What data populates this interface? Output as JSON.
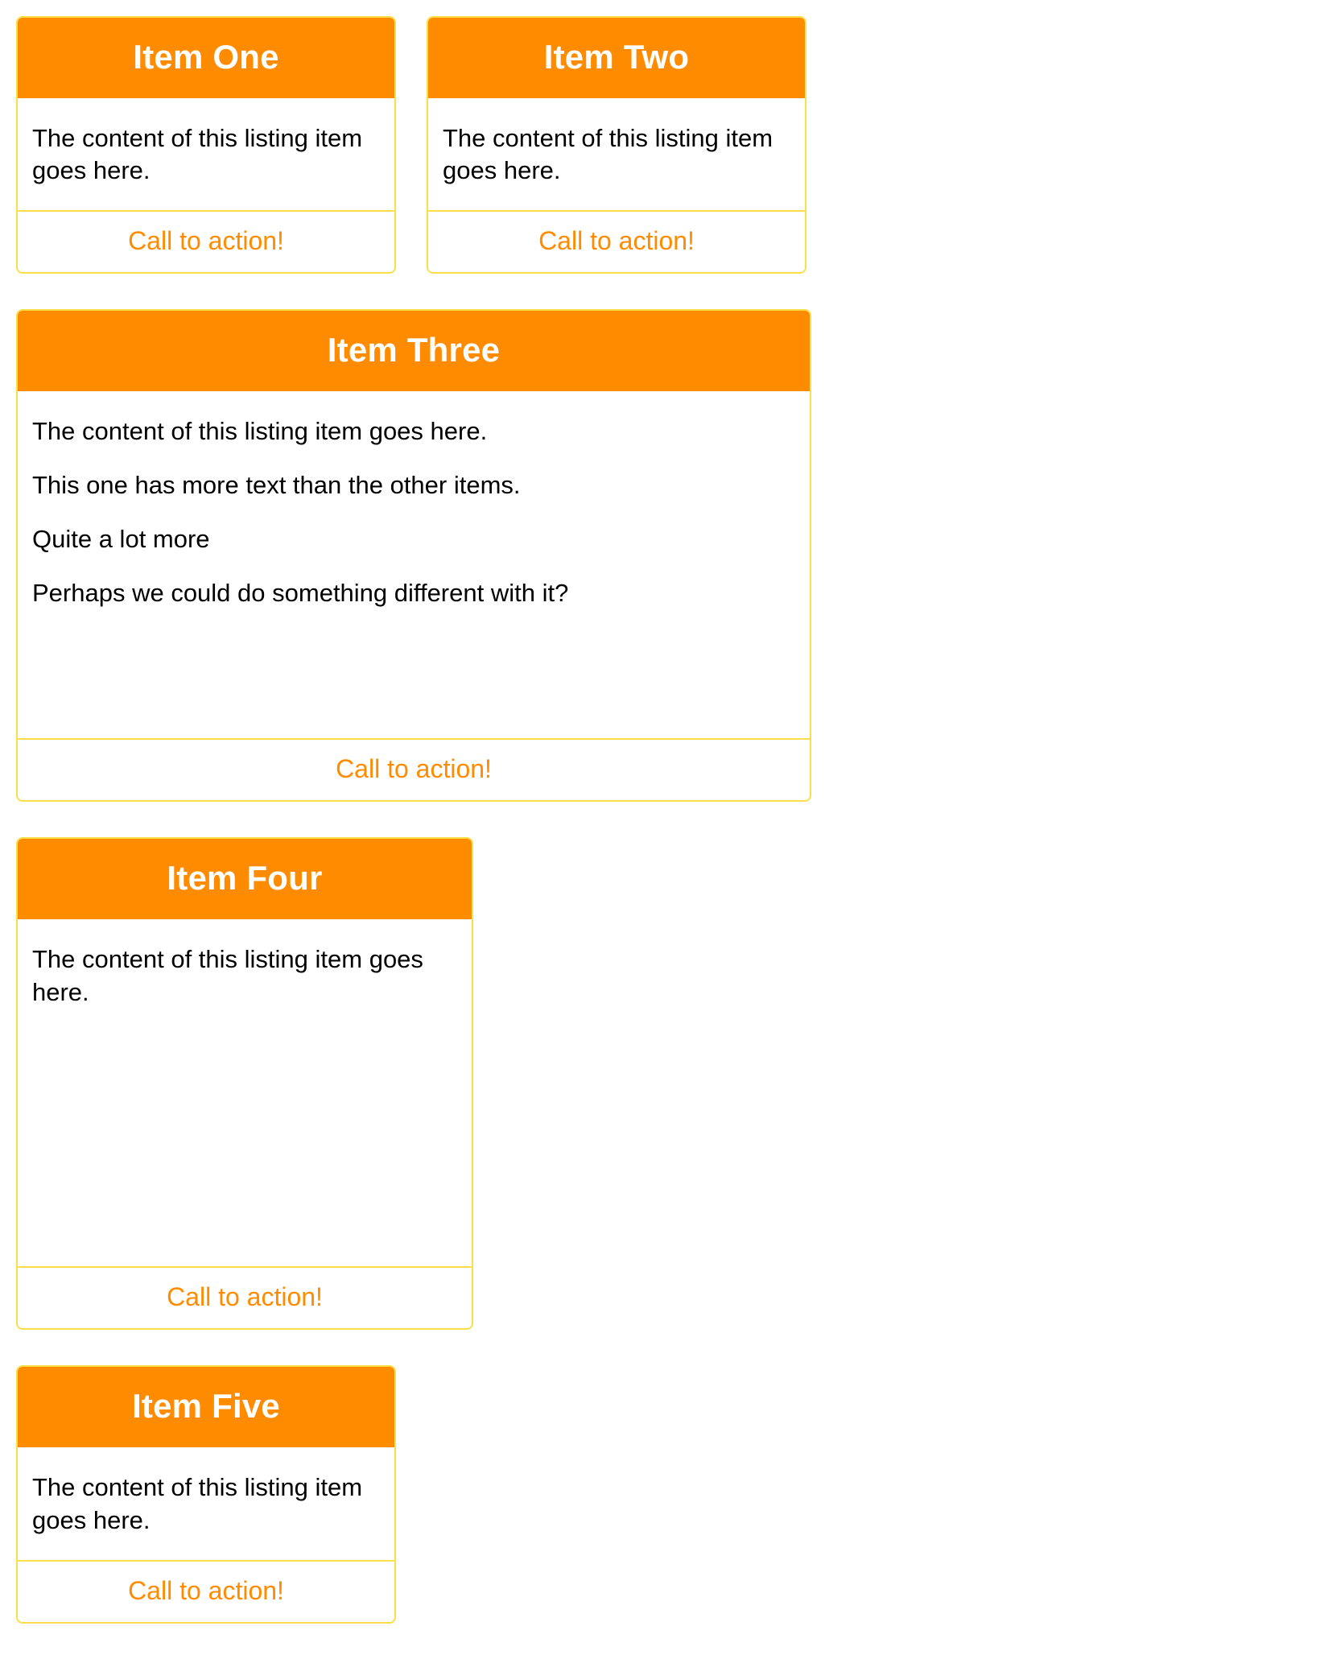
{
  "theme": {
    "header_bg": "#FF8C00",
    "header_text": "#FFFFFF",
    "border": "#F9DF4A",
    "cta_color": "#FF8C00",
    "body_text": "#000000",
    "page_bg": "#FFFFFF"
  },
  "listing": {
    "items": [
      {
        "title": "Item One",
        "paragraphs": [
          "The content of this listing item goes here."
        ],
        "cta_label": "Call to action!"
      },
      {
        "title": "Item Two",
        "paragraphs": [
          "The content of this listing item goes here."
        ],
        "cta_label": "Call to action!"
      },
      {
        "title": "Item Three",
        "paragraphs": [
          "The content of this listing item goes here.",
          "This one has more text than the other items.",
          "Quite a lot more",
          "Perhaps we could do something different with it?"
        ],
        "cta_label": "Call to action!"
      },
      {
        "title": "Item Four",
        "paragraphs": [
          "The content of this listing item goes here."
        ],
        "cta_label": "Call to action!"
      },
      {
        "title": "Item Five",
        "paragraphs": [
          "The content of this listing item goes here."
        ],
        "cta_label": "Call to action!"
      }
    ]
  }
}
